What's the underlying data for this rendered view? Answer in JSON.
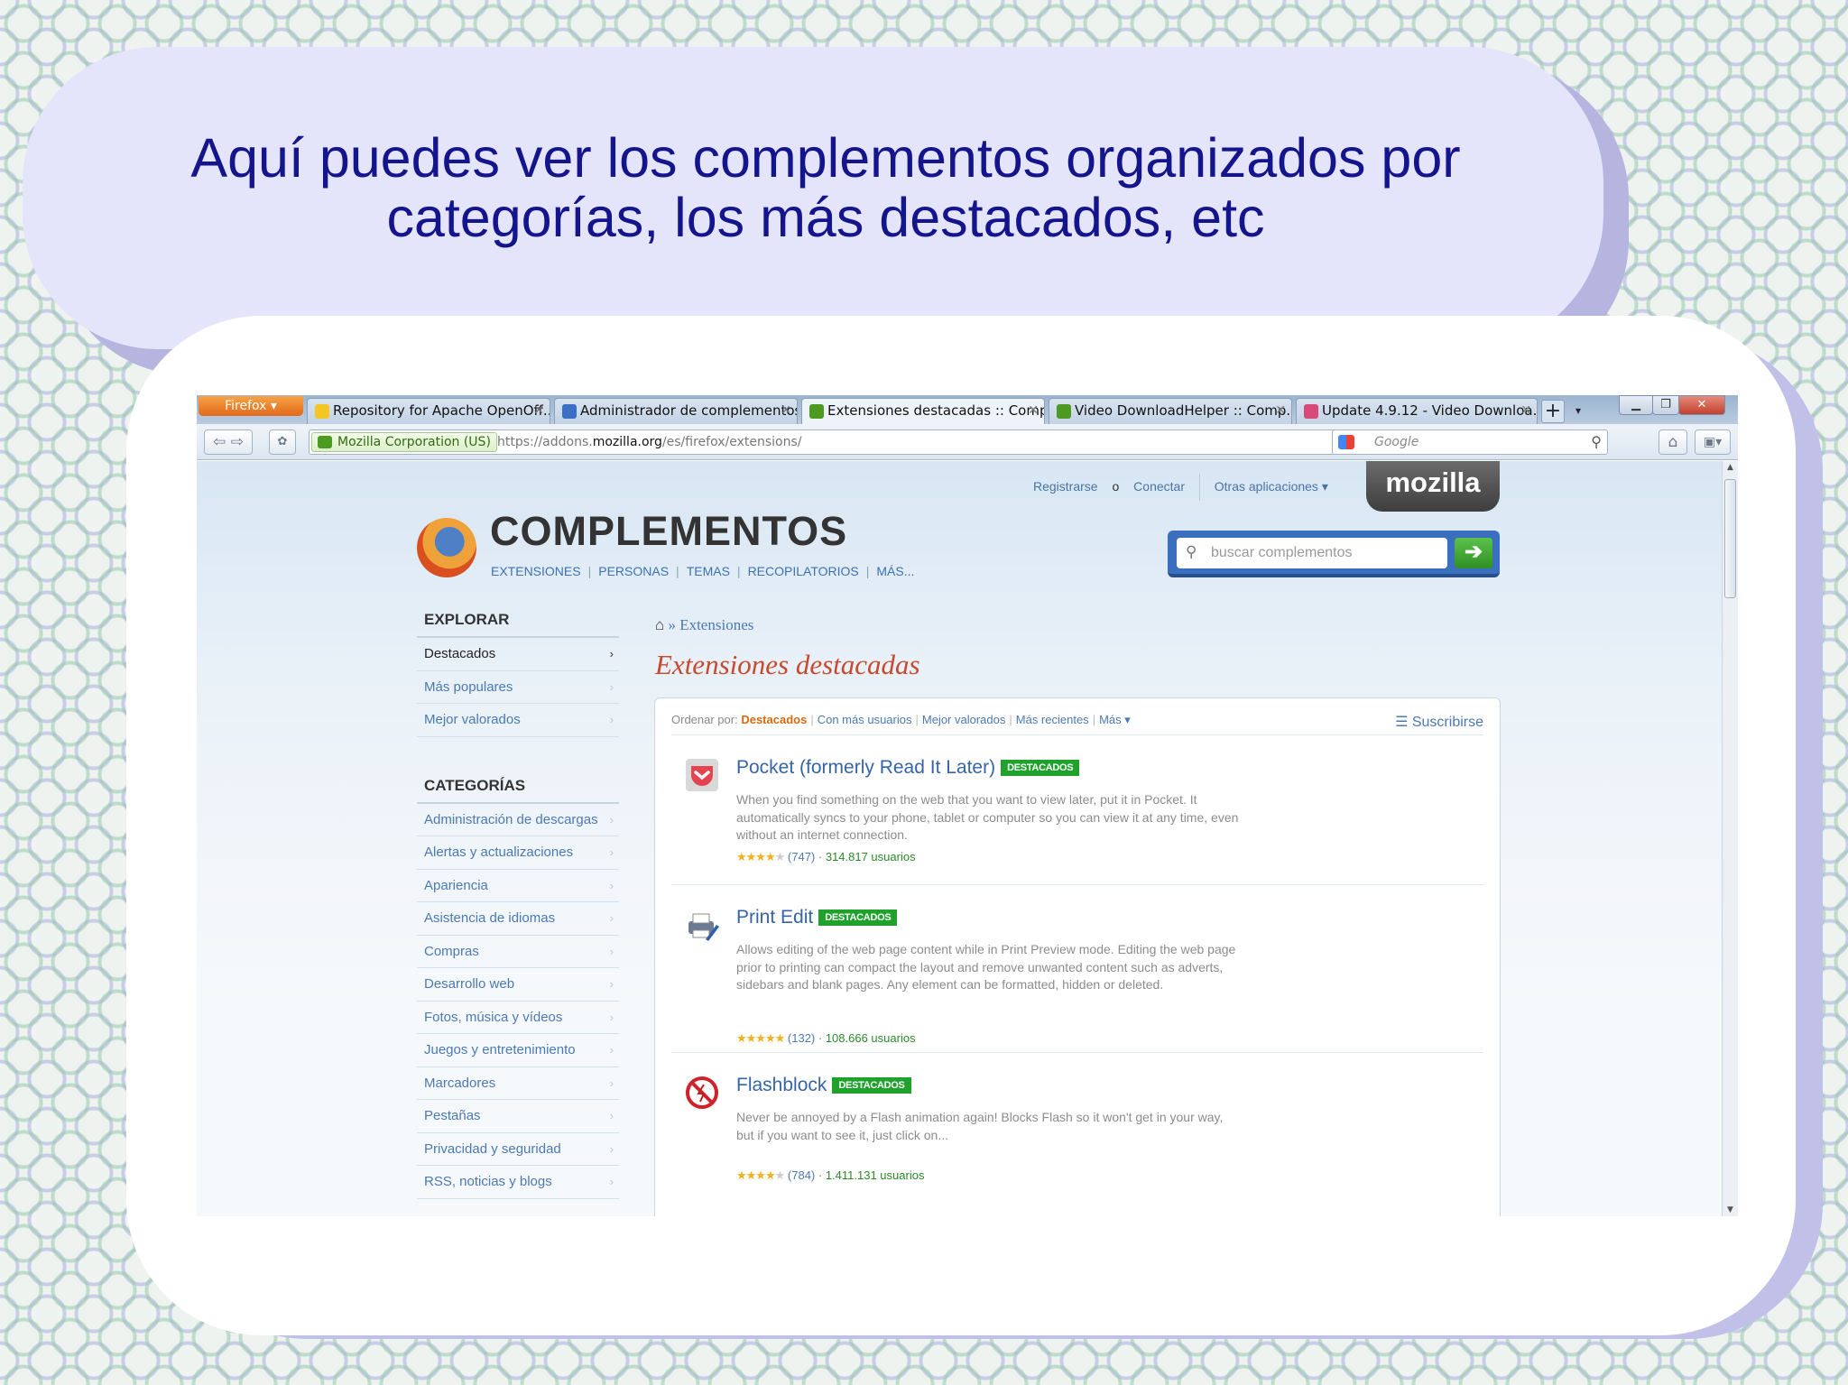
{
  "slide": {
    "title_line1": "Aquí puedes ver los complementos organizados por",
    "title_line2": "categorías, los más destacados, etc"
  },
  "browser": {
    "menu_button": "Firefox ▾",
    "tabs": [
      {
        "label": "Repository for Apache OpenOff...",
        "icon_color": "#f3c623",
        "active": false
      },
      {
        "label": "Administrador de complementos",
        "icon_color": "#3a6fc4",
        "active": false
      },
      {
        "label": "Extensiones destacadas :: Comp...",
        "icon_color": "#4c9a1f",
        "active": true
      },
      {
        "label": "Video DownloadHelper :: Comp...",
        "icon_color": "#4c9a1f",
        "active": false
      },
      {
        "label": "Update 4.9.12 - Video Downloa...",
        "icon_color": "#d94a7a",
        "active": false
      }
    ],
    "new_tab": "+",
    "identity": "Mozilla Corporation (US)",
    "url_prefix": "https://addons.",
    "url_domain": "mozilla.org",
    "url_suffix": "/es/firefox/extensions/",
    "search_engine_placeholder": "Google"
  },
  "page": {
    "top_links": {
      "register": "Registrarse",
      "or": "o",
      "connect": "Conectar",
      "other_apps": "Otras aplicaciones ▾"
    },
    "mozilla_badge": "mozilla",
    "brand": "COMPLEMENTOS",
    "subnav": [
      "EXTENSIONES",
      "PERSONAS",
      "TEMAS",
      "RECOPILATORIOS",
      "MÁS..."
    ],
    "search_placeholder": "buscar complementos",
    "sidebar": {
      "explore_heading": "EXPLORAR",
      "explore_items": [
        "Destacados",
        "Más populares",
        "Mejor valorados"
      ],
      "categories_heading": "CATEGORÍAS",
      "categories": [
        "Administración de descargas",
        "Alertas y actualizaciones",
        "Apariencia",
        "Asistencia de idiomas",
        "Compras",
        "Desarrollo web",
        "Fotos, música y vídeos",
        "Juegos y entretenimiento",
        "Marcadores",
        "Pestañas",
        "Privacidad y seguridad",
        "RSS, noticias y blogs"
      ]
    },
    "breadcrumb": "» Extensiones",
    "page_title": "Extensiones destacadas",
    "sort": {
      "label": "Ordenar por:",
      "options": [
        "Destacados",
        "Con más usuarios",
        "Mejor valorados",
        "Más recientes",
        "Más ▾"
      ]
    },
    "subscribe": "Suscribirse",
    "badge_label": "DESTACADOS",
    "addons": [
      {
        "name": "Pocket (formerly Read It Later)",
        "description": "When you find something on the web that you want to view later, put it in Pocket. It automatically syncs to your phone, tablet or computer so you can view it at any time, even without an internet connection.",
        "stars": 4,
        "reviews": "(747)",
        "users": "314.817 usuarios",
        "icon": "pocket-icon"
      },
      {
        "name": "Print Edit",
        "description": "Allows editing of the web page content while in Print Preview mode. Editing the web page prior to printing can compact the layout and remove unwanted content such as adverts, sidebars and blank pages. Any element can be formatted, hidden or deleted.",
        "stars": 5,
        "reviews": "(132)",
        "users": "108.666 usuarios",
        "icon": "printer-icon"
      },
      {
        "name": "Flashblock",
        "description": "Never be annoyed by a Flash animation again! Blocks Flash so it won't get in your way, but if you want to see it, just click on...",
        "stars": 4,
        "reviews": "(784)",
        "users": "1.411.131 usuarios",
        "icon": "flashblock-icon"
      }
    ]
  }
}
